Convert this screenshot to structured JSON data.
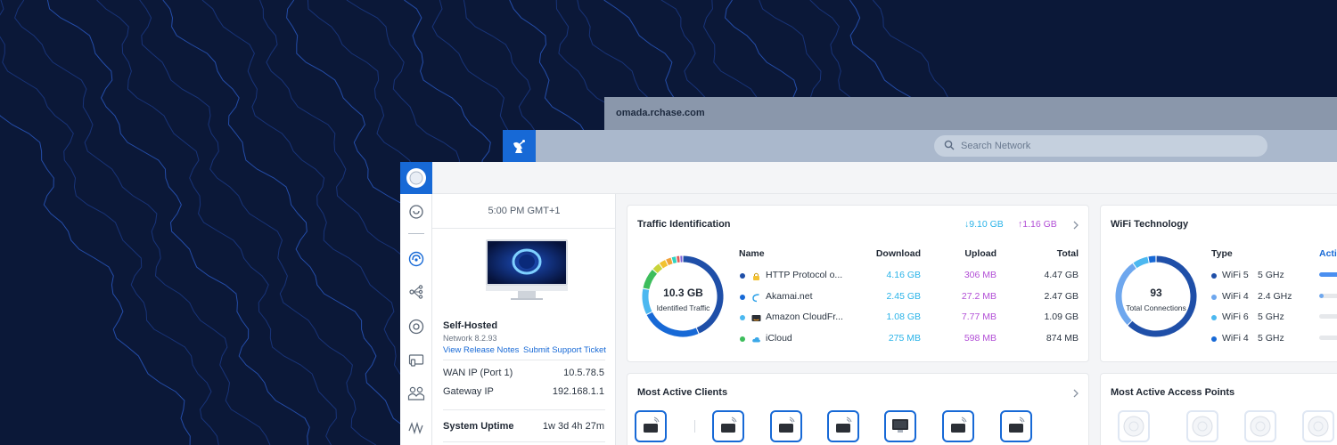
{
  "browser": {
    "url": "omada.rchase.com"
  },
  "header": {
    "search_placeholder": "Search Network"
  },
  "left_panel": {
    "time": "5:00 PM GMT+1",
    "hosting": "Self-Hosted",
    "version": "Network 8.2.93",
    "release_notes": "View Release Notes",
    "support": "Submit Support Ticket",
    "wan_label": "WAN IP (Port 1)",
    "wan_value": "10.5.78.5",
    "gateway_label": "Gateway IP",
    "gateway_value": "192.168.1.1",
    "uptime_label": "System Uptime",
    "uptime_value": "1w 3d 4h 27m"
  },
  "traffic": {
    "title": "Traffic Identification",
    "download_total": "↓9.10 GB",
    "upload_total": "↑1.16 GB",
    "center_value": "10.3 GB",
    "center_label": "Identified Traffic",
    "columns": {
      "name": "Name",
      "download": "Download",
      "upload": "Upload",
      "total": "Total"
    },
    "rows": [
      {
        "name": "HTTP Protocol o...",
        "download": "4.16 GB",
        "upload": "306 MB",
        "total": "4.47 GB",
        "dot": "#1f4fa8",
        "icon": "lock-icon"
      },
      {
        "name": "Akamai.net",
        "download": "2.45 GB",
        "upload": "27.2 MB",
        "total": "2.47 GB",
        "dot": "#1769d6",
        "icon": "akamai-icon"
      },
      {
        "name": "Amazon CloudFr...",
        "download": "1.08 GB",
        "upload": "7.77 MB",
        "total": "1.09 GB",
        "dot": "#4cb8f0",
        "icon": "aws-icon"
      },
      {
        "name": "iCloud",
        "download": "275 MB",
        "upload": "598 MB",
        "total": "874 MB",
        "dot": "#3dbd5c",
        "icon": "cloud-icon"
      }
    ],
    "segments": [
      {
        "value": 4.47,
        "color": "#1f4fa8"
      },
      {
        "value": 2.47,
        "color": "#1769d6"
      },
      {
        "value": 1.09,
        "color": "#4cb8f0"
      },
      {
        "value": 0.874,
        "color": "#3dbd5c"
      },
      {
        "value": 0.35,
        "color": "#c8d43a"
      },
      {
        "value": 0.3,
        "color": "#f2c230"
      },
      {
        "value": 0.25,
        "color": "#f0a23a"
      },
      {
        "value": 0.2,
        "color": "#2ed3c0"
      },
      {
        "value": 0.15,
        "color": "#e05a5a"
      },
      {
        "value": 0.12,
        "color": "#7d5fd6"
      }
    ]
  },
  "wifi": {
    "title": "WiFi Technology",
    "center_value": "93",
    "center_label": "Total Connections",
    "columns": {
      "type": "Type",
      "activity": "Acti"
    },
    "rows": [
      {
        "gen": "WiFi 5",
        "band": "5 GHz",
        "dot": "#1f4fa8",
        "level": 0.9
      },
      {
        "gen": "WiFi 4",
        "band": "2.4 GHz",
        "dot": "#6ea7ee",
        "level": 0.15
      },
      {
        "gen": "WiFi 6",
        "band": "5 GHz",
        "dot": "#4cb8f0",
        "level": 0
      },
      {
        "gen": "WiFi 4",
        "band": "5 GHz",
        "dot": "#1769d6",
        "level": 0
      }
    ],
    "segments": [
      {
        "value": 58,
        "color": "#1f4fa8"
      },
      {
        "value": 26,
        "color": "#6ea7ee"
      },
      {
        "value": 6,
        "color": "#4cb8f0"
      },
      {
        "value": 3,
        "color": "#1769d6"
      }
    ]
  },
  "clients": {
    "title": "Most Active Clients"
  },
  "access_points": {
    "title": "Most Active Access Points"
  }
}
